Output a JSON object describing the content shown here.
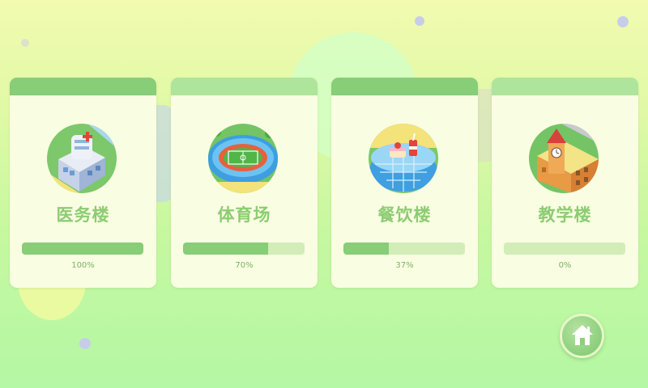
{
  "buildings": [
    {
      "name": "医务楼",
      "progress": 100,
      "progress_label": "100%",
      "icon": "hospital-building-icon"
    },
    {
      "name": "体育场",
      "progress": 70,
      "progress_label": "70%",
      "icon": "stadium-icon"
    },
    {
      "name": "餐饮楼",
      "progress": 37,
      "progress_label": "37%",
      "icon": "restaurant-building-icon"
    },
    {
      "name": "教学楼",
      "progress": 0,
      "progress_label": "0%",
      "icon": "school-building-icon"
    }
  ],
  "home_button": {
    "icon": "home-icon"
  },
  "colors": {
    "accent": "#88cd78",
    "accent_light": "#aee49c",
    "track": "#d2edb8",
    "card": "#f9fde2",
    "text": "#8ccc72"
  }
}
